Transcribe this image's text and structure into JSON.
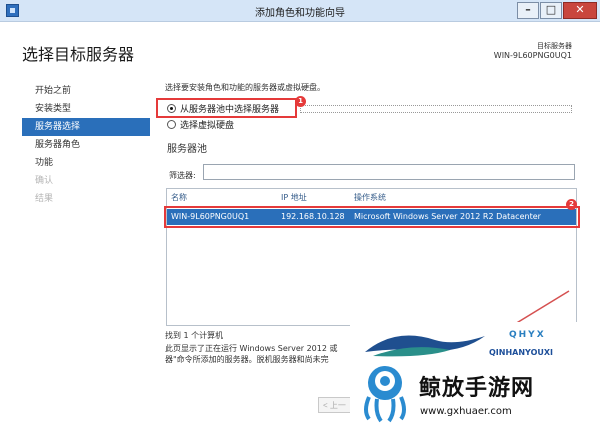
{
  "window": {
    "title": "添加角色和功能向导",
    "min_label": "–",
    "max_label": "□",
    "close_label": "✕"
  },
  "header": {
    "page_title": "选择目标服务器",
    "target_label": "目标服务器",
    "target_name": "WIN-9L60PNG0UQ1"
  },
  "nav": {
    "items": [
      {
        "label": "开始之前",
        "state": "normal"
      },
      {
        "label": "安装类型",
        "state": "normal"
      },
      {
        "label": "服务器选择",
        "state": "active"
      },
      {
        "label": "服务器角色",
        "state": "normal"
      },
      {
        "label": "功能",
        "state": "normal"
      },
      {
        "label": "确认",
        "state": "disabled"
      },
      {
        "label": "结果",
        "state": "disabled"
      }
    ]
  },
  "main": {
    "intro": "选择要安装角色和功能的服务器或虚拟硬盘。",
    "options": [
      {
        "label": "从服务器池中选择服务器",
        "checked": true
      },
      {
        "label": "选择虚拟硬盘",
        "checked": false
      }
    ],
    "badge1": "1",
    "badge2": "2",
    "pool_title": "服务器池",
    "filter_label": "筛选器:",
    "filter_value": "",
    "table": {
      "columns": [
        "名称",
        "IP 地址",
        "操作系统"
      ],
      "rows": [
        [
          "WIN-9L60PNG0UQ1",
          "192.168.10.128",
          "Microsoft Windows Server 2012 R2 Datacenter"
        ]
      ]
    },
    "found": "找到 1 个计算机",
    "desc_line1": "此页显示了正在运行 Windows Server 2012 或",
    "desc_line2": "器\"命令所添加的服务器。脱机服务器和尚未完"
  },
  "footer": {
    "prev_label": "< 上一"
  },
  "watermark": {
    "brand": "QHYX",
    "sub": "QINHANYOUXI",
    "cn": "鲸放手游网",
    "url": "www.gxhuaer.com"
  },
  "colors": {
    "accent": "#2a6fba",
    "highlight_red": "#e53a3a",
    "titlebar": "#d5e5f7"
  }
}
